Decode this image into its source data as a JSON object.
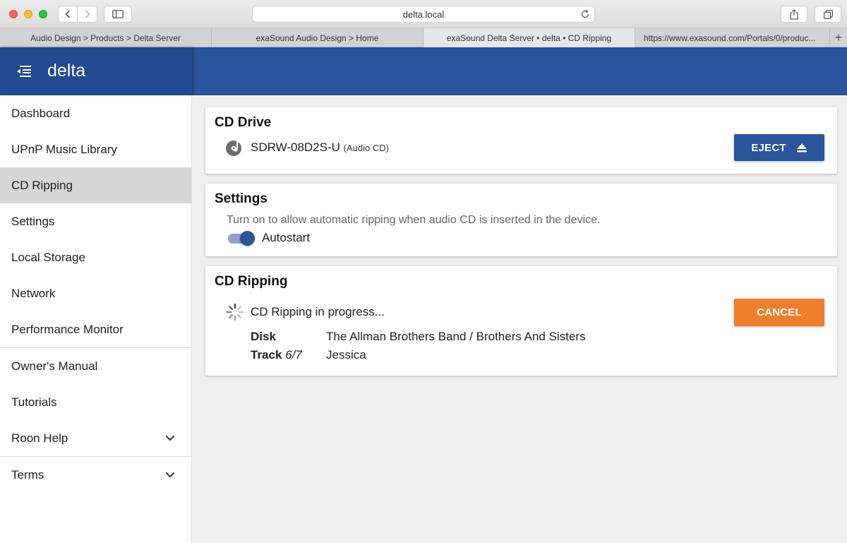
{
  "browser": {
    "address": "delta.local",
    "tabs": [
      {
        "label": "Audio Design > Products > Delta Server",
        "active": false
      },
      {
        "label": "exaSound Audio Design > Home",
        "active": false
      },
      {
        "label": "exaSound Delta Server • delta • CD Ripping",
        "active": true
      },
      {
        "label": "https://www.exasound.com/Portals/0/produc...",
        "active": false
      }
    ],
    "new_tab_symbol": "+"
  },
  "header": {
    "brand": "delta",
    "menu_icon": "menu-collapse-icon",
    "color": "#2a549c"
  },
  "sidebar": {
    "items": [
      {
        "label": "Dashboard"
      },
      {
        "label": "UPnP Music Library"
      },
      {
        "label": "CD Ripping",
        "active": true
      },
      {
        "label": "Settings"
      },
      {
        "label": "Local Storage"
      },
      {
        "label": "Network"
      },
      {
        "label": "Performance Monitor"
      },
      {
        "label": "Owner's Manual"
      },
      {
        "label": "Tutorials"
      },
      {
        "label": "Roon Help",
        "expandable": true
      },
      {
        "label": "Terms",
        "expandable": true
      }
    ]
  },
  "cd_drive": {
    "title": "CD Drive",
    "drive_name": "SDRW-08D2S-U",
    "drive_type": "(Audio CD)",
    "eject_label": "EJECT",
    "icon": "disc-icon"
  },
  "settings": {
    "title": "Settings",
    "description": "Turn on to allow automatic ripping when audio CD is inserted in the device.",
    "autostart_label": "Autostart",
    "autostart_on": true
  },
  "ripping": {
    "title": "CD Ripping",
    "status": "CD Ripping in progress...",
    "cancel_label": "CANCEL",
    "cancel_color": "#f07f2c",
    "disk_label": "Disk",
    "disk_value": "The Allman Brothers Band / Brothers And Sisters",
    "track_label": "Track",
    "track_number": "6/7",
    "track_value": "Jessica"
  }
}
